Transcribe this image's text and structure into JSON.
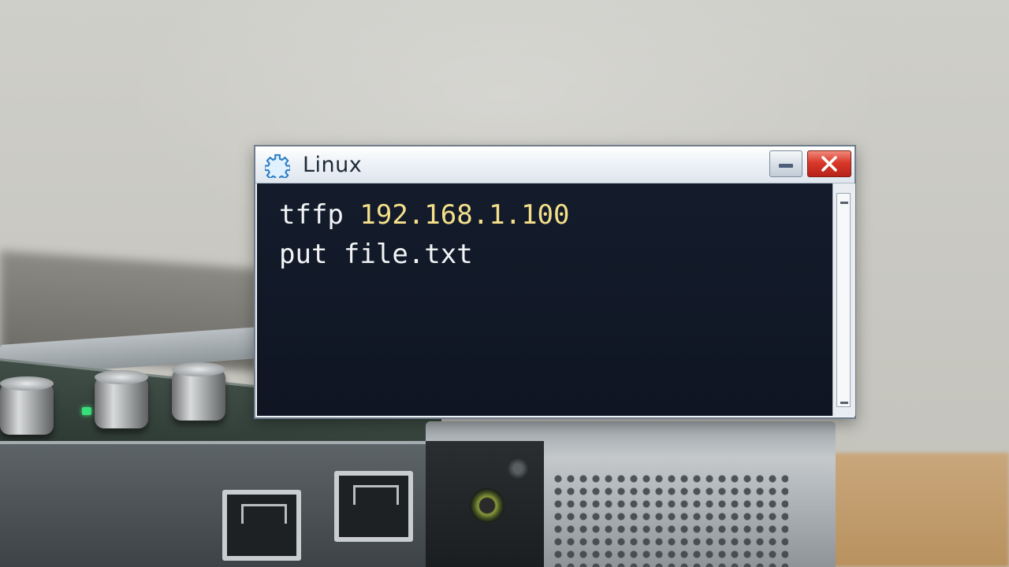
{
  "window": {
    "title": "Linux",
    "icon": "gear-icon",
    "minimize_icon": "minimize-icon",
    "close_icon": "close-icon",
    "colors": {
      "terminal_bg": "#111826",
      "text": "#f2f4f6",
      "ip_highlight": "#f5e08a",
      "close_button": "#d9392a"
    }
  },
  "terminal": {
    "lines": [
      {
        "command": "tffp",
        "argument": "192.168.1.100"
      },
      {
        "command": "put",
        "argument": "file.txt"
      }
    ]
  }
}
